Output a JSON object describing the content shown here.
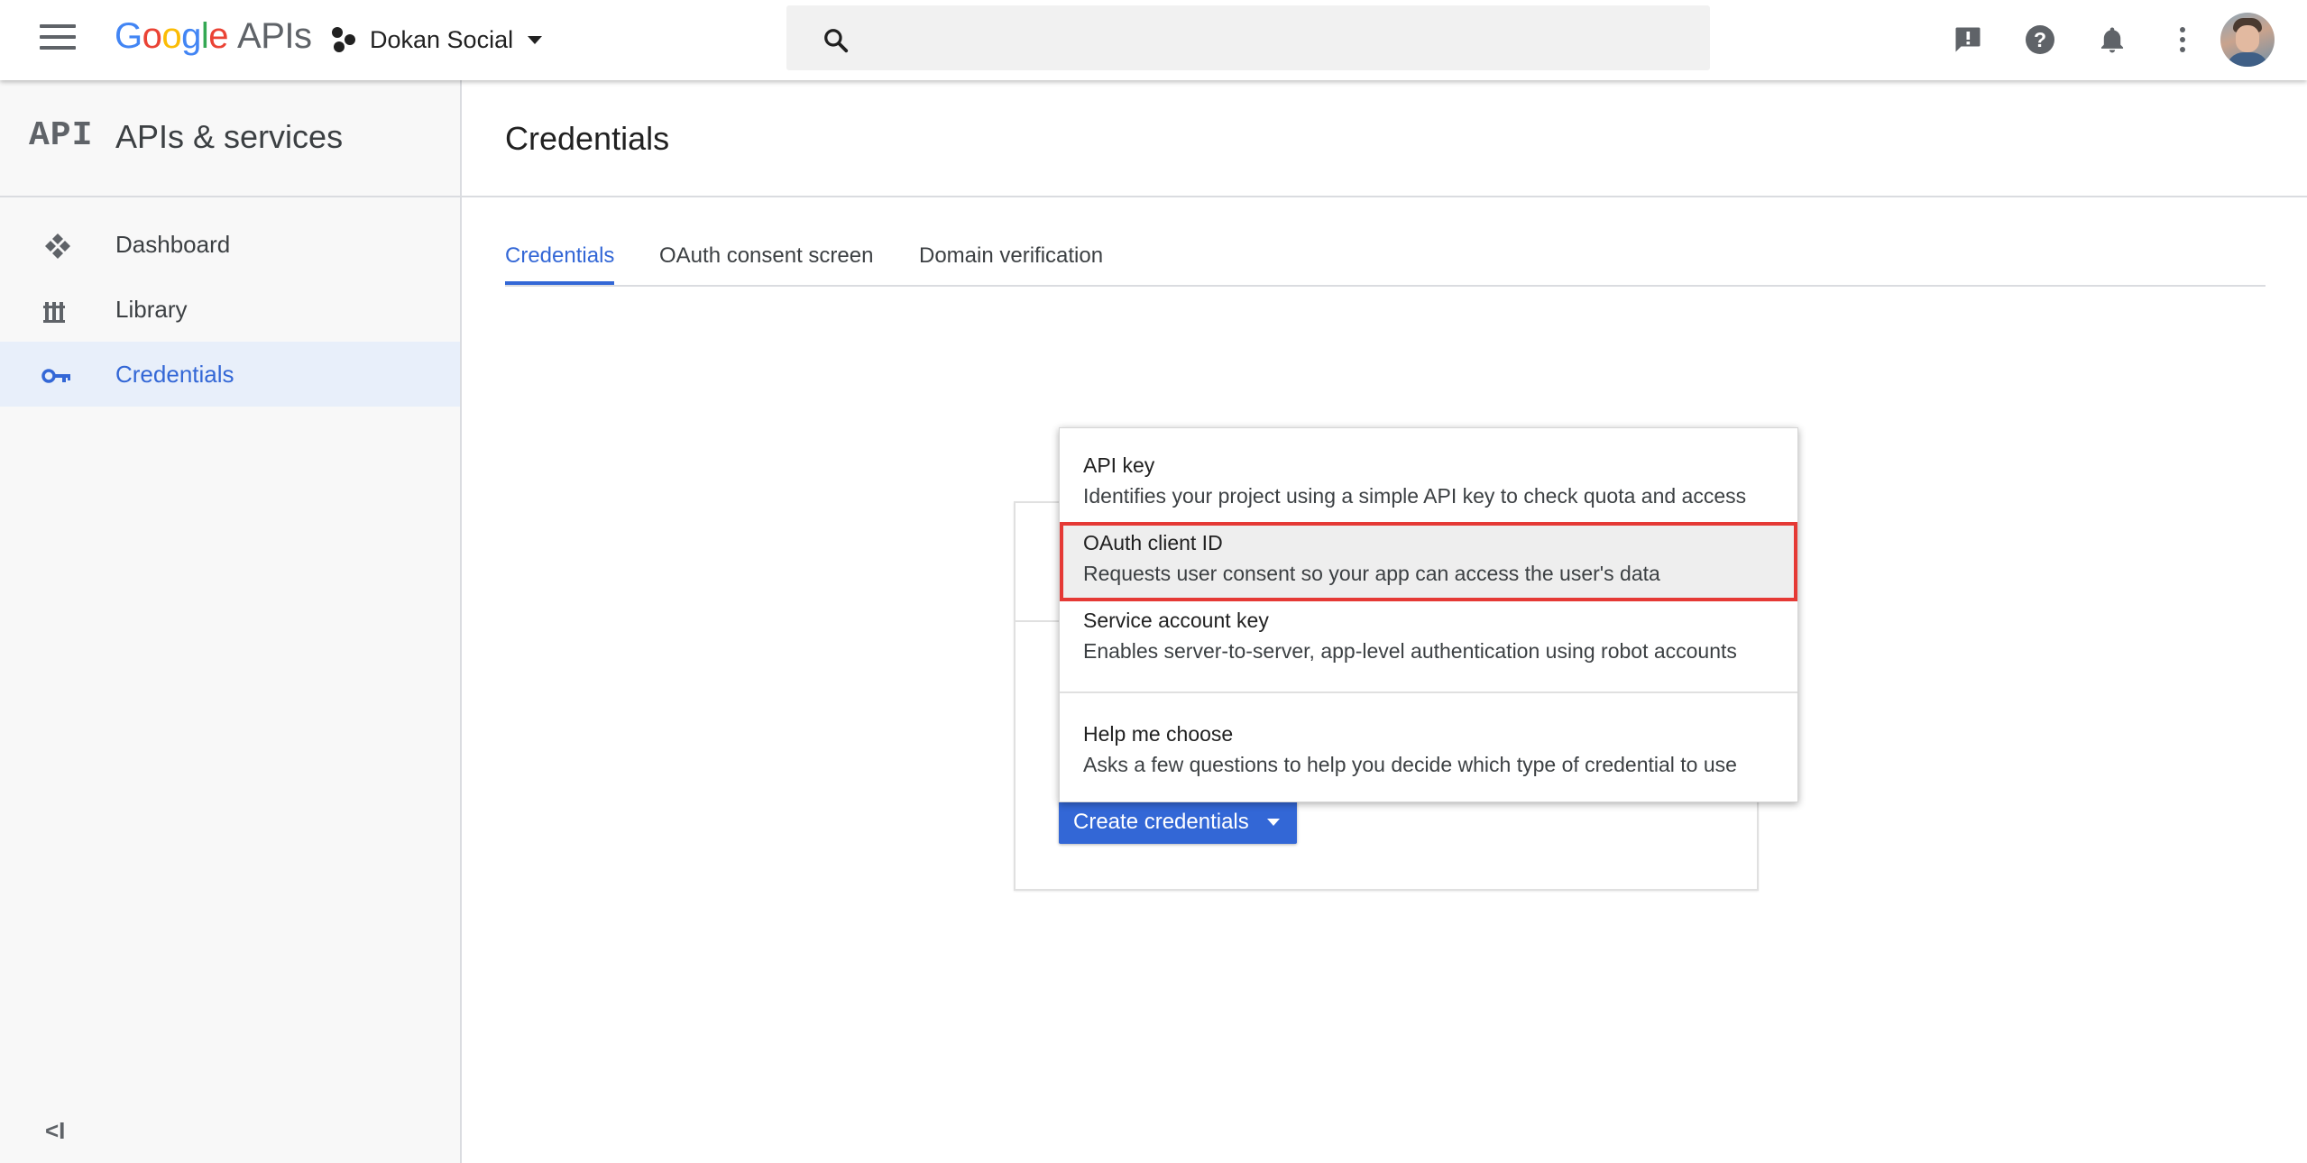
{
  "topbar": {
    "logo": {
      "google_letters": [
        "G",
        "o",
        "o",
        "g",
        "l",
        "e"
      ],
      "apis": "APIs"
    },
    "project_name": "Dokan Social",
    "search_placeholder": "",
    "icons": [
      "menu-icon",
      "search-icon",
      "feedback-icon",
      "help-icon",
      "notifications-icon",
      "more-vert-icon",
      "account-avatar"
    ]
  },
  "sidebar": {
    "api_logo": "API",
    "title": "APIs & services",
    "items": [
      {
        "label": "Dashboard",
        "icon": "dashboard-icon",
        "active": false
      },
      {
        "label": "Library",
        "icon": "library-icon",
        "active": false
      },
      {
        "label": "Credentials",
        "icon": "key-icon",
        "active": true
      }
    ],
    "collapse_icon": "<I"
  },
  "main": {
    "title": "Credentials",
    "tabs": [
      {
        "label": "Credentials",
        "active": true
      },
      {
        "label": "OAuth consent screen",
        "active": false
      },
      {
        "label": "Domain verification",
        "active": false
      }
    ],
    "create_button": "Create credentials"
  },
  "menu": {
    "items": [
      {
        "title": "API key",
        "desc": "Identifies your project using a simple API key to check quota and access"
      },
      {
        "title": "OAuth client ID",
        "desc": "Requests user consent so your app can access the user's data",
        "highlighted": true
      },
      {
        "title": "Service account key",
        "desc": "Enables server-to-server, app-level authentication using robot accounts"
      },
      {
        "title": "Help me choose",
        "desc": "Asks a few questions to help you decide which type of credential to use"
      }
    ]
  },
  "colors": {
    "accent": "#3367d6",
    "highlight_border": "#e53935",
    "sidebar_bg": "#f8f8f8",
    "active_item_bg": "#e8effa"
  }
}
